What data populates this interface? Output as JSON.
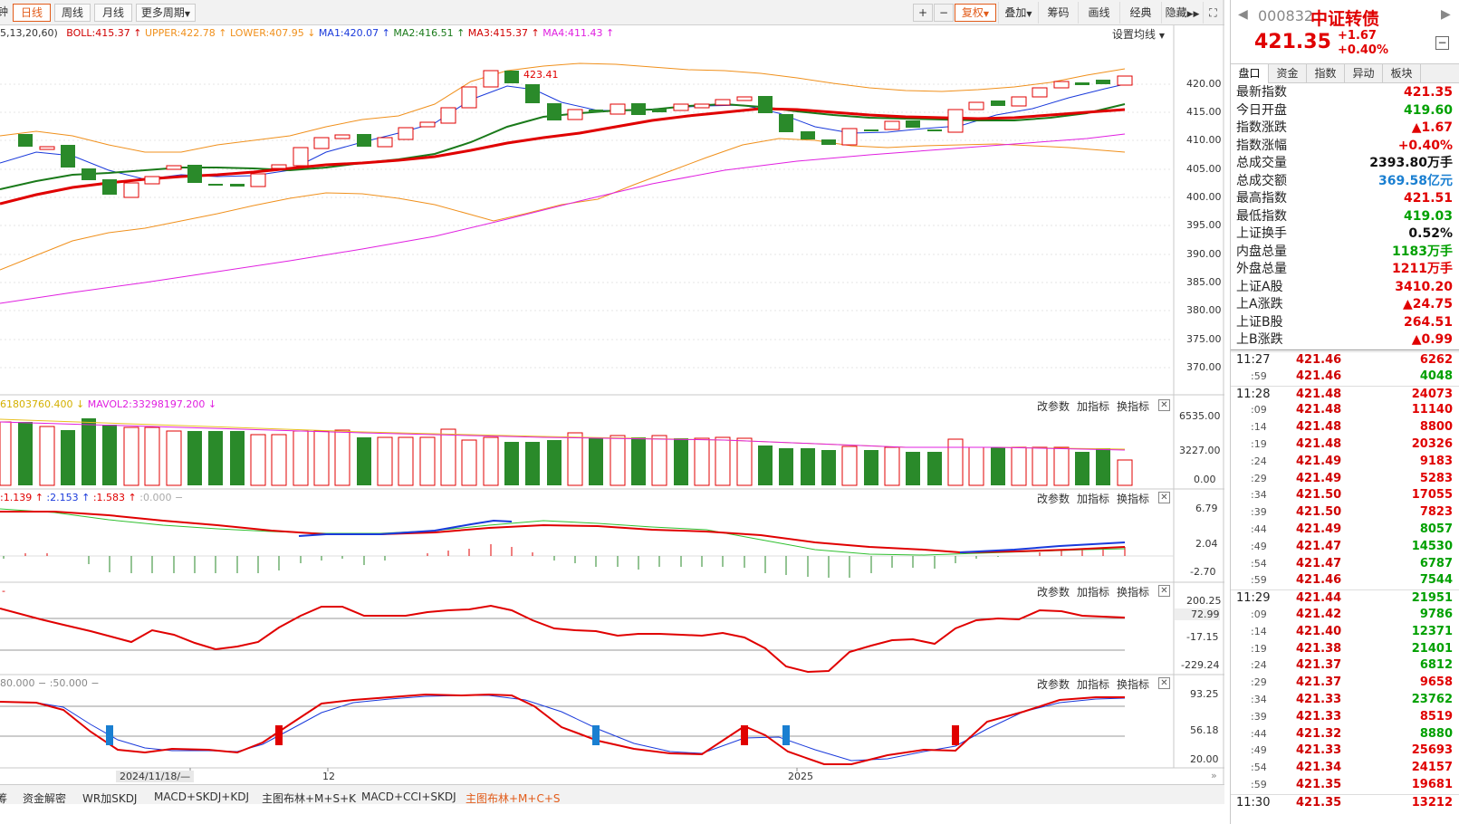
{
  "toolbar": {
    "left_stub": "钟",
    "tabs": [
      "日线",
      "周线",
      "月线",
      "更多周期"
    ],
    "adjust": "复权",
    "overlay": "叠加",
    "chips": "筹码",
    "draw": "画线",
    "classic": "经典",
    "hide": "隐藏"
  },
  "main": {
    "legend": {
      "params": "5,13,20,60)",
      "boll": "BOLL:415.37",
      "upper": "UPPER:422.78",
      "lower": "LOWER:407.95",
      "ma1": "MA1:420.07",
      "ma2": "MA2:416.51",
      "ma3": "MA3:415.37",
      "ma4": "MA4:411.43"
    },
    "set_ma": "设置均线",
    "peak_label": "423.41",
    "yaxis": [
      "420.00",
      "415.00",
      "410.00",
      "405.00",
      "400.00",
      "395.00",
      "390.00",
      "385.00",
      "380.00",
      "375.00",
      "370.00"
    ]
  },
  "vol": {
    "legend1": "61803760.400",
    "legend2": "MAVOL2:33298197.200",
    "yaxis": [
      "6535.00",
      "3227.00",
      "0.00"
    ]
  },
  "macd": {
    "legend1": ":1.139",
    "legend2": ":2.153",
    "legend3": ":1.583",
    "legend4": ":0.000",
    "yaxis": [
      "6.79",
      "2.04",
      "-2.70"
    ]
  },
  "cci": {
    "legend": "-",
    "yaxis": [
      "200.25",
      "72.99",
      "-17.15",
      "-229.24"
    ]
  },
  "kdj": {
    "legend1": "80.000",
    "legend2": ":50.000",
    "yaxis": [
      "93.25",
      "56.18",
      "20.00"
    ]
  },
  "panel_buttons": {
    "params": "改参数",
    "add": "加指标",
    "switch": "换指标"
  },
  "xaxis": {
    "cursor_date": "2024/11/18/—",
    "month_12": "12",
    "year_2025": "2025"
  },
  "bottom_tabs": [
    "筹",
    "资金解密",
    "WR加SKDJ",
    "MACD+SKDJ+KDJ",
    "主图布林+M+S+K",
    "MACD+CCI+SKDJ",
    "主图布林+M+C+S"
  ],
  "quote": {
    "code": "000832",
    "name": "中证转债",
    "price": "421.35",
    "change": "+1.67",
    "pct": "+0.40%"
  },
  "tabs": [
    "盘口",
    "资金",
    "指数",
    "异动",
    "板块"
  ],
  "stats": [
    {
      "k": "最新指数",
      "v": "421.35",
      "c": "red"
    },
    {
      "k": "今日开盘",
      "v": "419.60",
      "c": "green"
    },
    {
      "k": "指数涨跌",
      "v": "▲1.67",
      "c": "red"
    },
    {
      "k": "指数涨幅",
      "v": "+0.40%",
      "c": "red"
    },
    {
      "k": "总成交量",
      "v": "2393.80万手",
      "c": "black"
    },
    {
      "k": "总成交额",
      "v": "369.58亿元",
      "c": "blue"
    },
    {
      "k": "最高指数",
      "v": "421.51",
      "c": "red"
    },
    {
      "k": "最低指数",
      "v": "419.03",
      "c": "green"
    },
    {
      "k": "上证换手",
      "v": "0.52%",
      "c": "black"
    },
    {
      "k": "内盘总量",
      "v": "1183万手",
      "c": "green"
    },
    {
      "k": "外盘总量",
      "v": "1211万手",
      "c": "red"
    },
    {
      "k": "上证A股",
      "v": "3410.20",
      "c": "red"
    },
    {
      "k": "上A涨跌",
      "v": "▲24.75",
      "c": "red"
    },
    {
      "k": "上证B股",
      "v": "264.51",
      "c": "red"
    },
    {
      "k": "上B涨跌",
      "v": "▲0.99",
      "c": "red"
    }
  ],
  "trades": [
    {
      "t": "11:27",
      "p": "421.46",
      "q": "6262",
      "c": "red"
    },
    {
      "t": ":59",
      "p": "421.46",
      "q": "4048",
      "c": "green"
    },
    {
      "t": "11:28",
      "p": "421.48",
      "q": "24073",
      "c": "red"
    },
    {
      "t": ":09",
      "p": "421.48",
      "q": "11140",
      "c": "red"
    },
    {
      "t": ":14",
      "p": "421.48",
      "q": "8800",
      "c": "red"
    },
    {
      "t": ":19",
      "p": "421.48",
      "q": "20326",
      "c": "red"
    },
    {
      "t": ":24",
      "p": "421.49",
      "q": "9183",
      "c": "red"
    },
    {
      "t": ":29",
      "p": "421.49",
      "q": "5283",
      "c": "red"
    },
    {
      "t": ":34",
      "p": "421.50",
      "q": "17055",
      "c": "red"
    },
    {
      "t": ":39",
      "p": "421.50",
      "q": "7823",
      "c": "red"
    },
    {
      "t": ":44",
      "p": "421.49",
      "q": "8057",
      "c": "green"
    },
    {
      "t": ":49",
      "p": "421.47",
      "q": "14530",
      "c": "green"
    },
    {
      "t": ":54",
      "p": "421.47",
      "q": "6787",
      "c": "green"
    },
    {
      "t": ":59",
      "p": "421.46",
      "q": "7544",
      "c": "green"
    },
    {
      "t": "11:29",
      "p": "421.44",
      "q": "21951",
      "c": "green"
    },
    {
      "t": ":09",
      "p": "421.42",
      "q": "9786",
      "c": "green"
    },
    {
      "t": ":14",
      "p": "421.40",
      "q": "12371",
      "c": "green"
    },
    {
      "t": ":19",
      "p": "421.38",
      "q": "21401",
      "c": "green"
    },
    {
      "t": ":24",
      "p": "421.37",
      "q": "6812",
      "c": "green"
    },
    {
      "t": ":29",
      "p": "421.37",
      "q": "9658",
      "c": "red"
    },
    {
      "t": ":34",
      "p": "421.33",
      "q": "23762",
      "c": "green"
    },
    {
      "t": ":39",
      "p": "421.33",
      "q": "8519",
      "c": "red"
    },
    {
      "t": ":44",
      "p": "421.32",
      "q": "8880",
      "c": "green"
    },
    {
      "t": ":49",
      "p": "421.33",
      "q": "25693",
      "c": "red"
    },
    {
      "t": ":54",
      "p": "421.34",
      "q": "24157",
      "c": "red"
    },
    {
      "t": ":59",
      "p": "421.35",
      "q": "19681",
      "c": "red"
    },
    {
      "t": "11:30",
      "p": "421.35",
      "q": "13212",
      "c": "red"
    }
  ]
}
